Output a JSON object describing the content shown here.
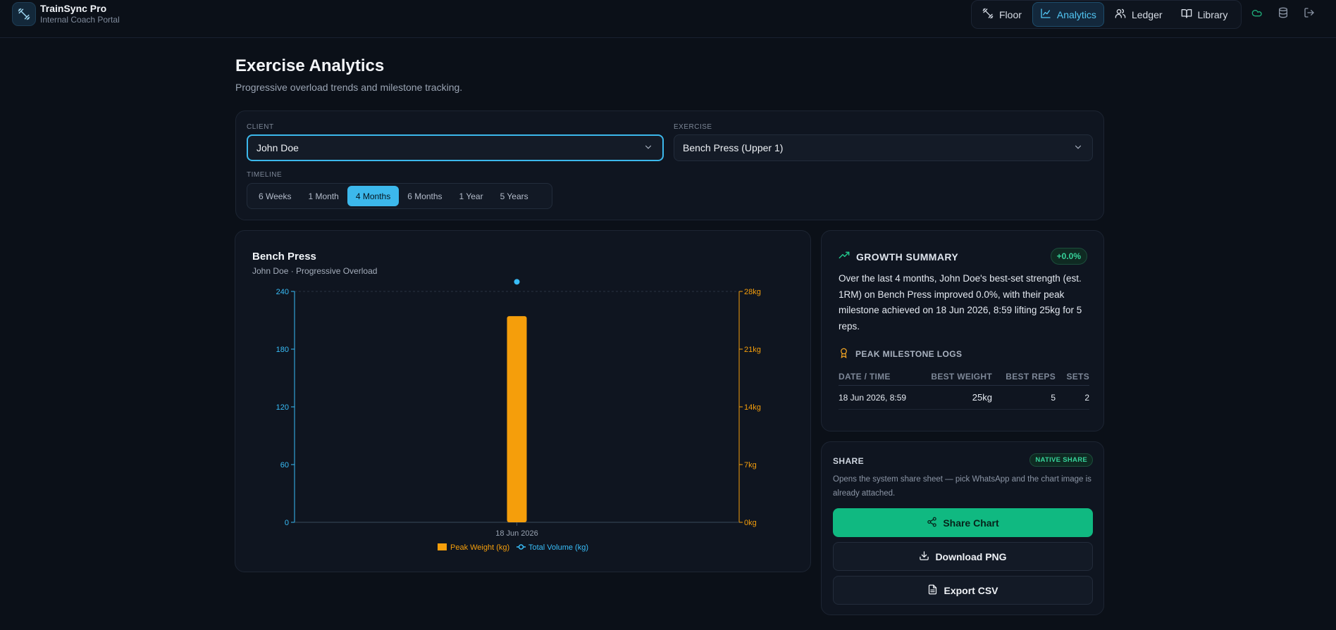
{
  "app": {
    "title": "TrainSync Pro",
    "subtitle": "Internal Coach Portal"
  },
  "nav": {
    "items": [
      {
        "label": "Floor",
        "icon": "dumbbell-icon",
        "active": false
      },
      {
        "label": "Analytics",
        "icon": "chart-line-icon",
        "active": true
      },
      {
        "label": "Ledger",
        "icon": "users-icon",
        "active": false
      },
      {
        "label": "Library",
        "icon": "book-open-icon",
        "active": false
      }
    ],
    "utility_icons": [
      "cloud-icon",
      "database-icon",
      "logout-icon"
    ]
  },
  "page": {
    "title": "Exercise Analytics",
    "subtitle": "Progressive overload trends and milestone tracking."
  },
  "filters": {
    "client_label": "CLIENT",
    "client_value": "John Doe",
    "exercise_label": "EXERCISE",
    "exercise_value": "Bench Press (Upper 1)",
    "timeline_label": "TIMELINE",
    "timeline_options": [
      "6 Weeks",
      "1 Month",
      "4 Months",
      "6 Months",
      "1 Year",
      "5 Years"
    ],
    "timeline_selected": "4 Months"
  },
  "chart": {
    "title": "Bench Press",
    "subtitle": "John Doe · Progressive Overload"
  },
  "chart_data": {
    "type": "bar",
    "categories": [
      "18 Jun 2026"
    ],
    "series": [
      {
        "name": "Peak Weight (kg)",
        "type": "bar",
        "axis": "right",
        "values": [
          25
        ],
        "color": "#f59e0b"
      },
      {
        "name": "Total Volume (kg)",
        "type": "line",
        "axis": "left",
        "values": [
          250
        ],
        "color": "#38bdf8"
      }
    ],
    "y_left": {
      "ticks": [
        "0",
        "60",
        "120",
        "180",
        "240"
      ],
      "range": [
        0,
        240
      ],
      "color": "#38bdf8"
    },
    "y_right": {
      "ticks": [
        "0kg",
        "7kg",
        "14kg",
        "21kg",
        "28kg"
      ],
      "range": [
        0,
        28
      ],
      "color": "#f59e0b"
    },
    "legend_position": "bottom"
  },
  "growth": {
    "title": "GROWTH SUMMARY",
    "badge": "+0.0%",
    "text": "Over the last 4 months, John Doe's best-set strength (est. 1RM) on Bench Press improved 0.0%, with their peak milestone achieved on 18 Jun 2026, 8:59 lifting 25kg for 5 reps.",
    "milestones_title": "PEAK MILESTONE LOGS",
    "columns": [
      "DATE / TIME",
      "BEST WEIGHT",
      "BEST REPS",
      "SETS"
    ],
    "rows": [
      [
        "18 Jun 2026, 8:59",
        "25kg",
        "5",
        "2"
      ]
    ]
  },
  "share": {
    "title": "SHARE",
    "badge": "NATIVE SHARE",
    "description": "Opens the system share sheet — pick WhatsApp and the chart image is already attached.",
    "share_label": "Share Chart",
    "download_label": "Download PNG",
    "export_label": "Export CSV"
  },
  "colors": {
    "accent": "#3cb8ec",
    "success": "#10b981",
    "bar": "#f59e0b",
    "line": "#38bdf8",
    "background": "#0b1018"
  }
}
